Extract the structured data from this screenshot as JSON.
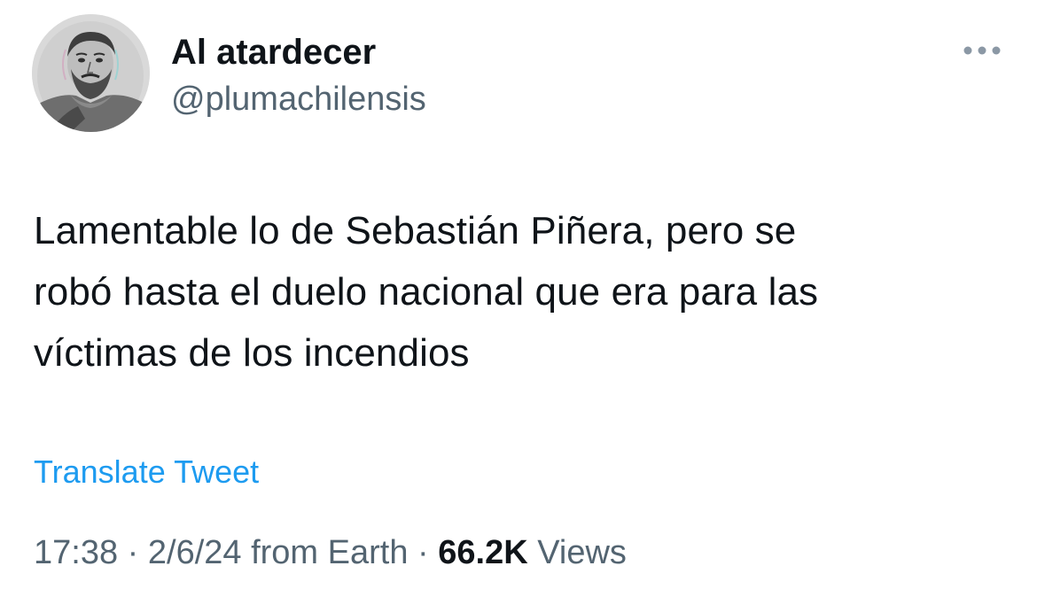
{
  "tweet": {
    "author": {
      "display_name": "Al atardecer",
      "handle": "@plumachilensis",
      "avatar_icon": "portrait-avatar"
    },
    "more_icon": "more-horizontal-icon",
    "text": "Lamentable lo de Sebastián Piñera, pero se\nrobó hasta el duelo nacional que era para las\nvíctimas de los incendios",
    "translate_label": "Translate Tweet",
    "meta": {
      "time": "17:38",
      "separator_1": " · ",
      "date": "2/6/24",
      "source": " from Earth",
      "separator_2": " · ",
      "views_count": "66.2K",
      "views_label": " Views"
    }
  },
  "colors": {
    "text_primary": "#0f1419",
    "text_secondary": "#536471",
    "link": "#1d9bf0",
    "background": "#ffffff"
  }
}
